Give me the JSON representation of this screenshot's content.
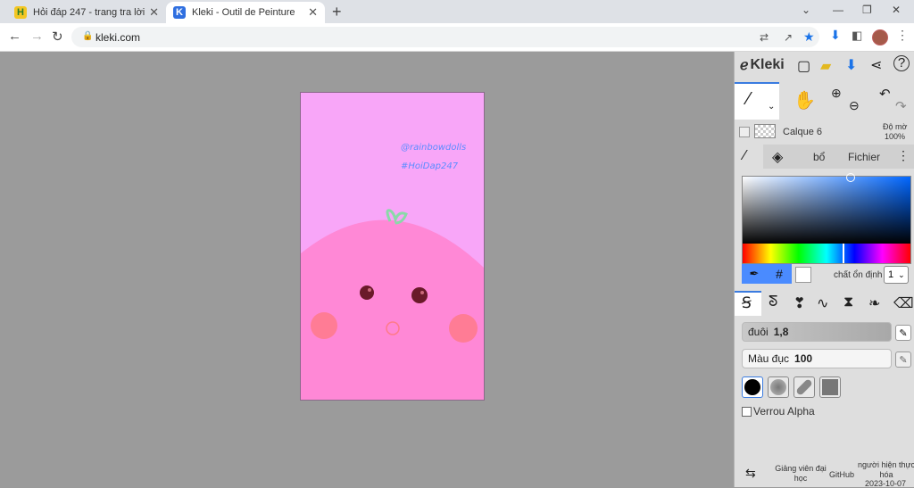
{
  "browser": {
    "tabs": [
      {
        "title": "Hỏi đáp 247 - trang tra lời"
      },
      {
        "title": "Kleki - Outil de Peinture"
      }
    ],
    "url": "kleki.com"
  },
  "canvas": {
    "text1": "@rainbowdolls",
    "text2": "#HoiDap247"
  },
  "panel": {
    "logo": "Kleki",
    "layer": {
      "name": "Calque 6",
      "opacity_label": "Độ mờ",
      "opacity_value": "100%"
    },
    "tabs": {
      "adjust": "bổ",
      "file": "Fichier"
    },
    "color": {
      "hex_symbol": "#",
      "stabilizer_label": "chất ổn định",
      "stabilizer_value": "1",
      "stabilizer_options": [
        "1"
      ]
    },
    "size": {
      "label": "đuôi",
      "value": "1,8"
    },
    "opacity": {
      "label": "Màu đục",
      "value": "100"
    },
    "alpha_lock": "Verrou Alpha",
    "footer": {
      "tutorials": "Giảng viên đại học",
      "github": "GitHub",
      "credits": "người hiện thực hóa",
      "date": "2023-10-07"
    }
  }
}
